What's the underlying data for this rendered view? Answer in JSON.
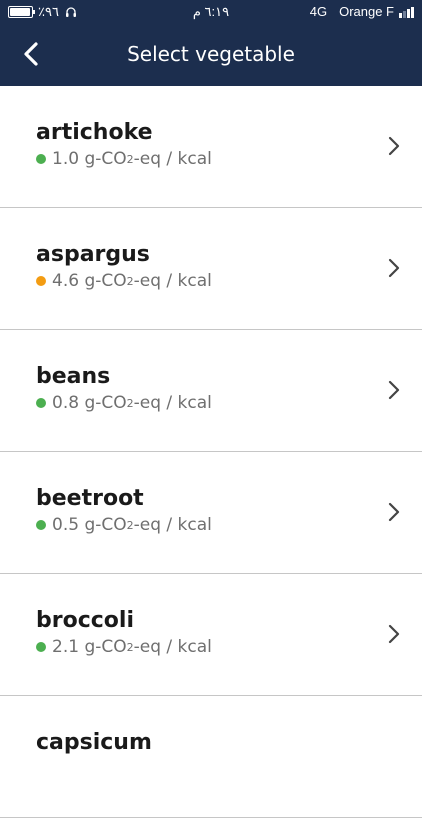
{
  "status_bar": {
    "battery_text": "٪٩٦",
    "battery_level": 0.96,
    "time": "٦:١٩ م",
    "network": "4G",
    "carrier": "Orange F"
  },
  "navbar": {
    "title": "Select vegetable"
  },
  "colors": {
    "nav_background": "#1c2e4e",
    "low_emission": "#4caf50",
    "medium_emission": "#f39c12"
  },
  "emission_unit": {
    "prefix": "g-CO",
    "subscript": "2",
    "suffix": "-eq / kcal"
  },
  "items": [
    {
      "name": "artichoke",
      "value": "1.0",
      "level": "low"
    },
    {
      "name": "aspargus",
      "value": "4.6",
      "level": "medium"
    },
    {
      "name": "beans",
      "value": "0.8",
      "level": "low"
    },
    {
      "name": "beetroot",
      "value": "0.5",
      "level": "low"
    },
    {
      "name": "broccoli",
      "value": "2.1",
      "level": "low"
    },
    {
      "name": "capsicum",
      "value": "",
      "level": ""
    }
  ]
}
